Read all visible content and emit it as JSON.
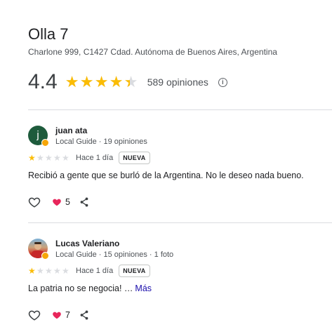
{
  "place": {
    "name": "Olla 7",
    "address": "Charlone 999, C1427 Cdad. Autónoma de Buenos Aires, Argentina",
    "rating": "4.4",
    "rating_fraction": 0.88,
    "reviews_count": "589 opiniones",
    "info_icon": "info-icon"
  },
  "colors": {
    "star": "#fbbc04",
    "star_empty": "#dadce0",
    "heart": "#e8265b",
    "avatar_juan": "#1e5b3c",
    "link": "#1a0dab"
  },
  "reviews": [
    {
      "avatar_letter": "j",
      "name": "juan ata",
      "meta": "Local Guide · 19 opiniones",
      "stars": 1,
      "date": "Hace 1 día",
      "badge": "NUEVA",
      "text": "Recibió a gente que se burló de la Argentina. No le deseo nada bueno.",
      "more": "",
      "likes": "5"
    },
    {
      "avatar_letter": "",
      "name": "Lucas Valeriano",
      "meta": "Local Guide · 15 opiniones · 1 foto",
      "stars": 1,
      "date": "Hace 1 día",
      "badge": "NUEVA",
      "text": "La patria no se negocia! …",
      "more": "Más",
      "likes": "7"
    }
  ]
}
